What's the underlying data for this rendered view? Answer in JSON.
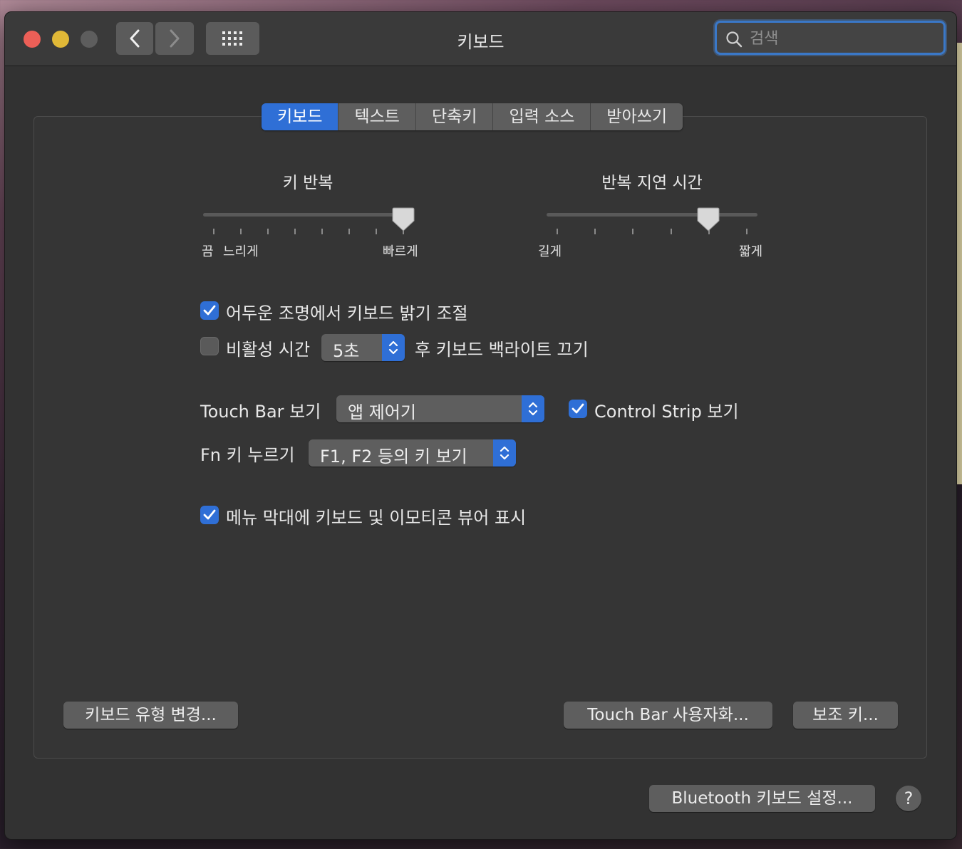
{
  "window": {
    "title": "키보드"
  },
  "search": {
    "placeholder": "검색"
  },
  "tabs": [
    {
      "label": "키보드",
      "active": true
    },
    {
      "label": "텍스트"
    },
    {
      "label": "단축키"
    },
    {
      "label": "입력 소스"
    },
    {
      "label": "받아쓰기"
    }
  ],
  "key_repeat": {
    "label": "키 반복",
    "min_label": "끔",
    "slow_label": "느리게",
    "fast_label": "빠르게",
    "level": 0.95
  },
  "repeat_delay": {
    "label": "반복 지연 시간",
    "long_label": "길게",
    "short_label": "짧게",
    "level": 0.8
  },
  "options": {
    "adjust_brightness": {
      "label": "어두운 조명에서 키보드 밝기 조절",
      "checked": true
    },
    "backlight_off": {
      "label_before": "비활성 시간",
      "value": "5초",
      "label_after": "후 키보드 백라이트 끄기",
      "checked": false
    },
    "touch_bar_show": {
      "label": "Touch Bar 보기",
      "value": "앱 제어기"
    },
    "control_strip": {
      "label": "Control Strip 보기",
      "checked": true
    },
    "fn_key": {
      "label": "Fn 키 누르기",
      "value": "F1, F2 등의 키 보기"
    },
    "menu_bar_viewer": {
      "label": "메뉴 막대에 키보드 및 이모티콘 뷰어 표시",
      "checked": true
    }
  },
  "buttons": {
    "change_keyboard_type": "키보드 유형 변경...",
    "customize_touch_bar": "Touch Bar 사용자화...",
    "modifier_keys": "보조 키...",
    "bluetooth_setup": "Bluetooth 키보드 설정...",
    "help": "?"
  },
  "colors": {
    "accent": "#2f6fd6",
    "window_bg": "#323232",
    "control_bg": "#5e5e5e"
  }
}
